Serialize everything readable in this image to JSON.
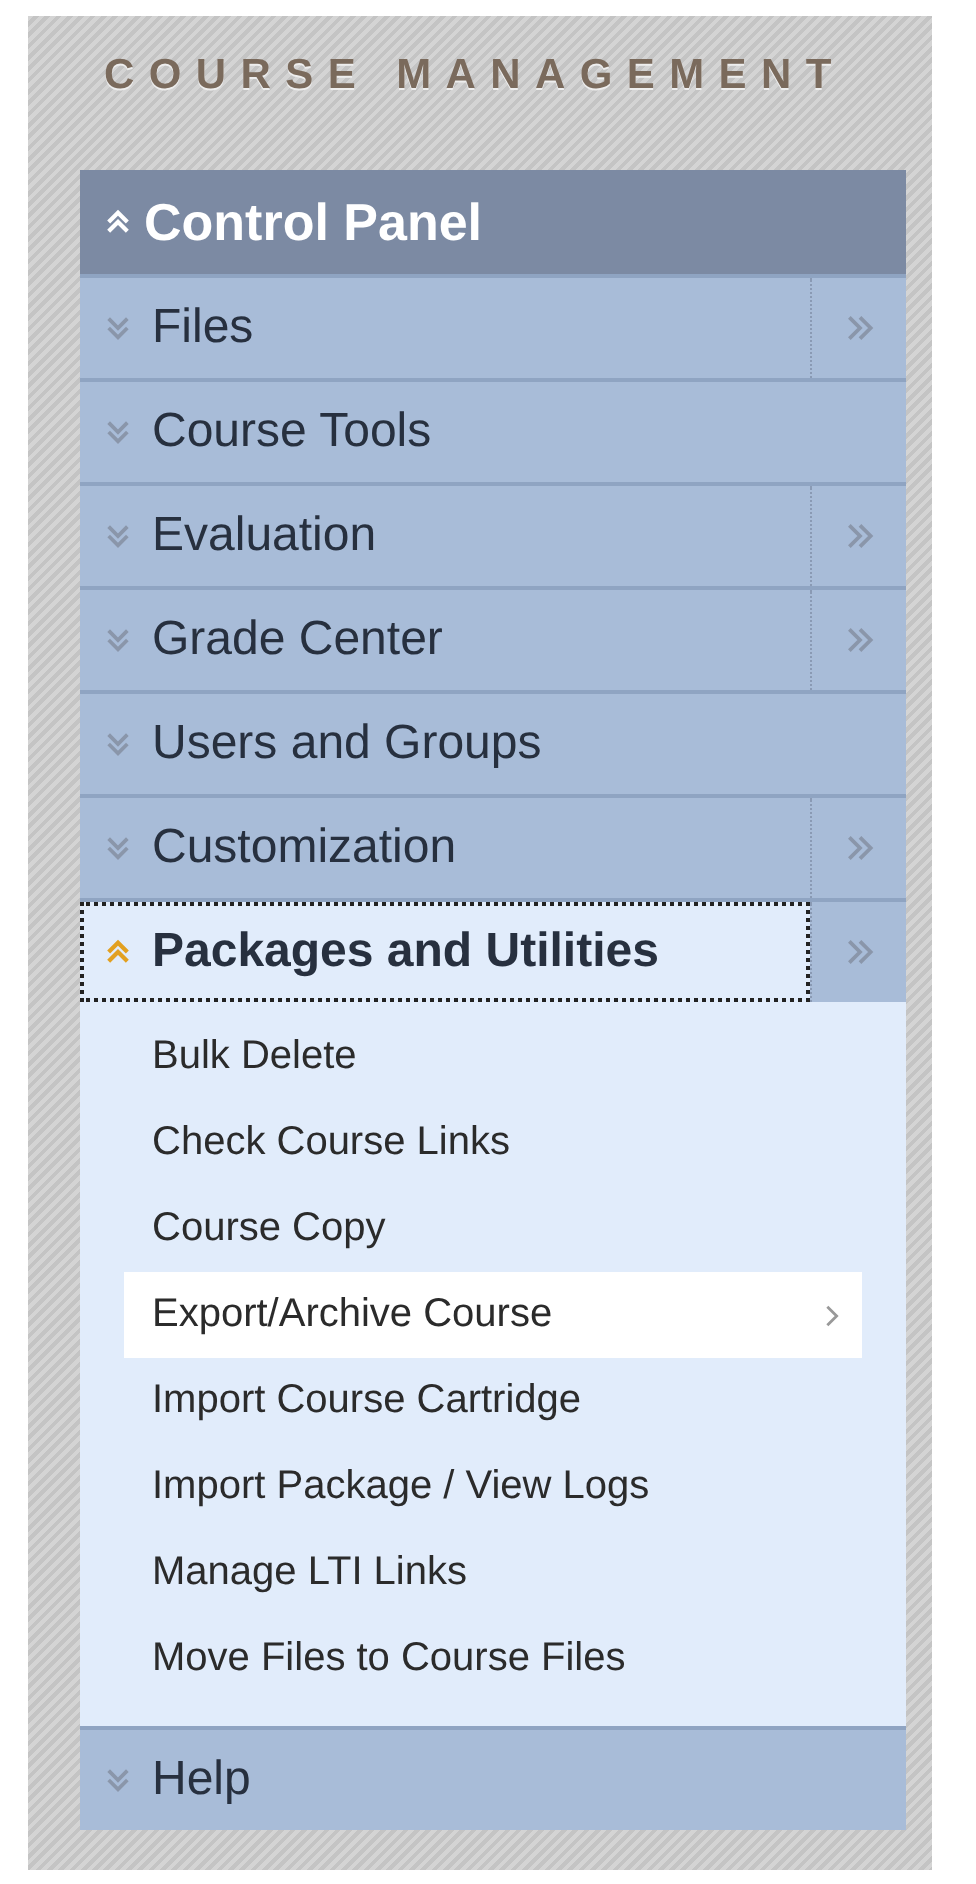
{
  "heading": "COURSE MANAGEMENT",
  "panel": {
    "title": "Control Panel",
    "expanded": true
  },
  "sections": [
    {
      "label": "Files",
      "expanded": false,
      "flyout": true,
      "focused": false
    },
    {
      "label": "Course Tools",
      "expanded": false,
      "flyout": false,
      "focused": false
    },
    {
      "label": "Evaluation",
      "expanded": false,
      "flyout": true,
      "focused": false
    },
    {
      "label": "Grade Center",
      "expanded": false,
      "flyout": true,
      "focused": false
    },
    {
      "label": "Users and Groups",
      "expanded": false,
      "flyout": false,
      "focused": false
    },
    {
      "label": "Customization",
      "expanded": false,
      "flyout": true,
      "focused": false
    },
    {
      "label": "Packages and Utilities",
      "expanded": true,
      "flyout": true,
      "focused": true,
      "items": [
        {
          "label": "Bulk Delete",
          "selected": false,
          "submenu": false
        },
        {
          "label": "Check Course Links",
          "selected": false,
          "submenu": false
        },
        {
          "label": "Course Copy",
          "selected": false,
          "submenu": false
        },
        {
          "label": "Export/Archive Course",
          "selected": true,
          "submenu": true
        },
        {
          "label": "Import Course Cartridge",
          "selected": false,
          "submenu": false
        },
        {
          "label": "Import Package / View Logs",
          "selected": false,
          "submenu": false
        },
        {
          "label": "Manage LTI Links",
          "selected": false,
          "submenu": false
        },
        {
          "label": "Move Files to Course Files",
          "selected": false,
          "submenu": false
        }
      ]
    },
    {
      "label": "Help",
      "expanded": false,
      "flyout": false,
      "focused": false
    }
  ]
}
